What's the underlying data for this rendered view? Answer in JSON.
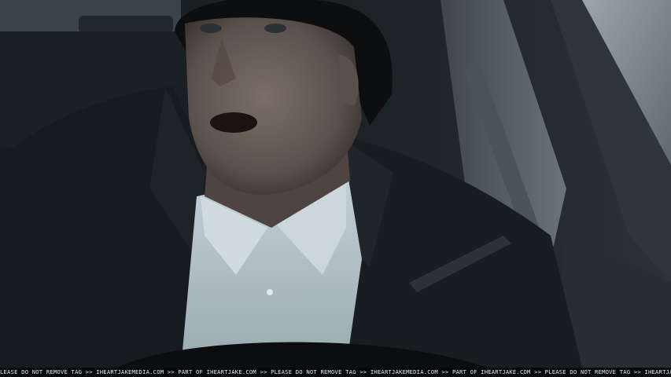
{
  "watermark": {
    "text": "LEASE DO NOT REMOVE TAG >> IHEARTJAKEMEDIA.COM >> PART OF IHEARTJAKE.COM >> PLEASE DO NOT REMOVE TAG >> IHEARTJAKEMEDIA.COM >> PART OF IHEARTJAKE.COM >> PLEASE DO NOT REMOVE TAG >> IHEARTJAKE"
  },
  "palette": {
    "interior_dark": "#12171a",
    "coat": "#171d20",
    "shirt": "#b8c6cc",
    "skin": "#6d625c",
    "beanie": "#0c0e10",
    "window_light": "#8a979e"
  }
}
